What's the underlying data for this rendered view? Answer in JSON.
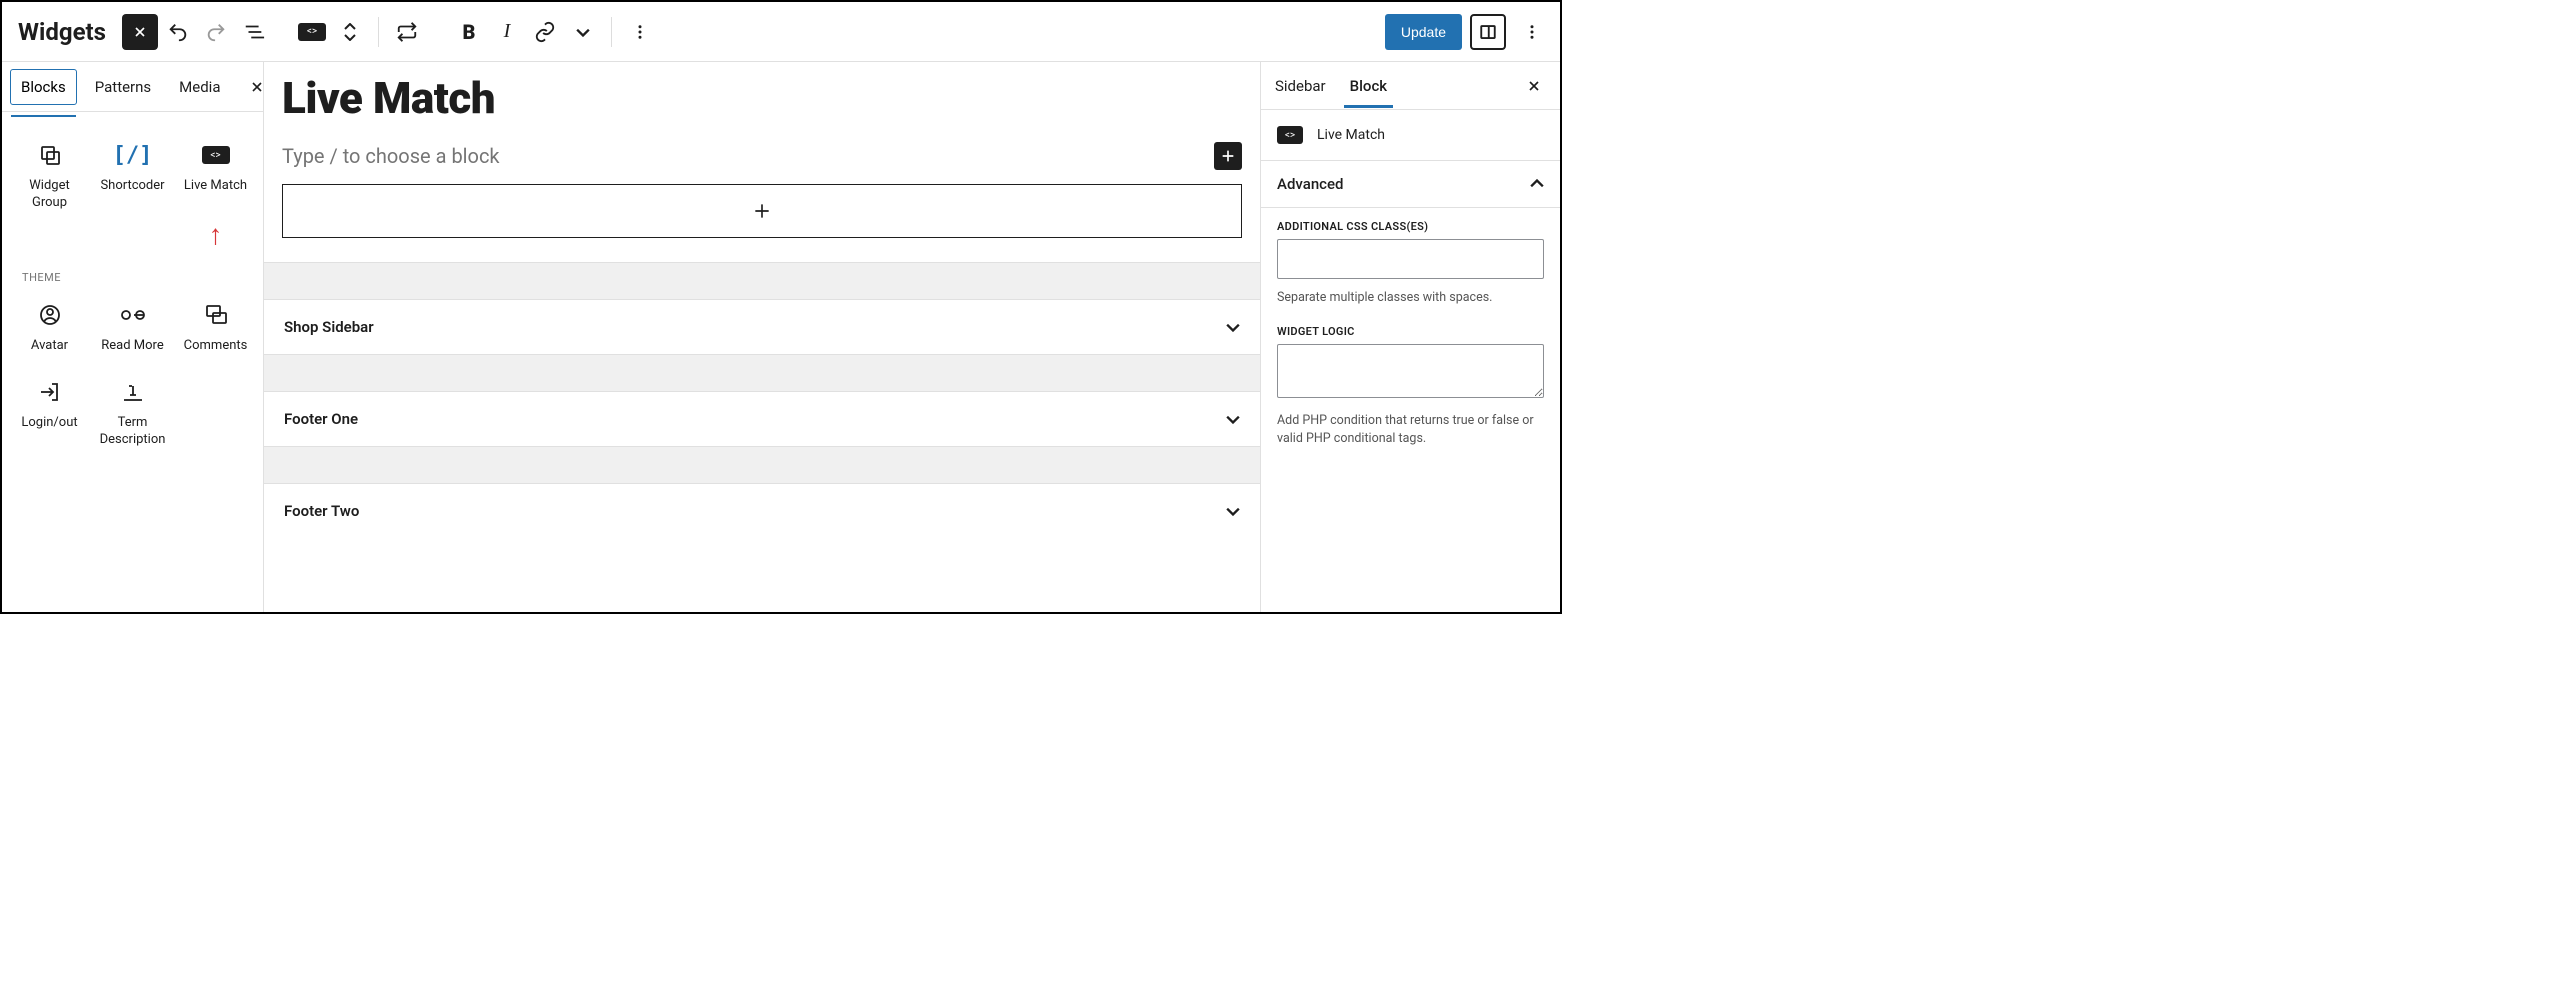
{
  "toolbar": {
    "page_title": "Widgets",
    "update_label": "Update"
  },
  "inserter": {
    "tabs": {
      "blocks": "Blocks",
      "patterns": "Patterns",
      "media": "Media"
    },
    "blocks": {
      "widget_group": "Widget Group",
      "shortcoder": "Shortcoder",
      "live_match": "Live Match"
    },
    "category_theme": "THEME",
    "theme_blocks": {
      "avatar": "Avatar",
      "read_more": "Read More",
      "comments": "Comments",
      "login_out": "Login/out",
      "term_description": "Term Description"
    }
  },
  "center": {
    "area_title": "Live Match",
    "placeholder": "Type / to choose a block",
    "collapsed_areas": [
      "Shop Sidebar",
      "Footer One",
      "Footer Two"
    ]
  },
  "settings": {
    "tabs": {
      "sidebar": "Sidebar",
      "block": "Block"
    },
    "block_name": "Live Match",
    "advanced_label": "Advanced",
    "css_label": "ADDITIONAL CSS CLASS(ES)",
    "css_help": "Separate multiple classes with spaces.",
    "widget_logic_label": "WIDGET LOGIC",
    "widget_logic_help": "Add PHP condition that returns true or false or valid PHP conditional tags."
  }
}
